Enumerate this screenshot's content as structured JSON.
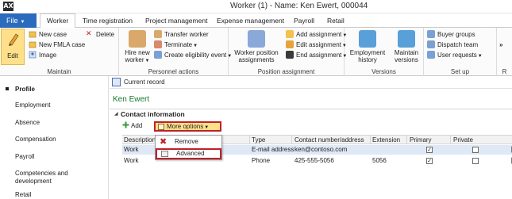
{
  "window": {
    "title": "Worker (1) - Name: Ken Ewert, 000044",
    "app_icon": "AX"
  },
  "ribbon_tabs": [
    {
      "label": "File"
    },
    {
      "label": "Worker"
    },
    {
      "label": "Time registration"
    },
    {
      "label": "Project management"
    },
    {
      "label": "Expense management"
    },
    {
      "label": "Payroll"
    },
    {
      "label": "Retail"
    }
  ],
  "ribbon": {
    "maintain": {
      "edit": "Edit",
      "new_case": "New case",
      "delete": "Delete",
      "new_fmla_case": "New FMLA case",
      "image": "Image",
      "label": "Maintain"
    },
    "personnel": {
      "hire_new": "Hire new",
      "worker": "worker",
      "transfer_worker": "Transfer worker",
      "terminate": "Terminate",
      "create_eligibility": "Create eligibility event",
      "label": "Personnel actions"
    },
    "position": {
      "worker_position": "Worker position",
      "assignments": "assignments",
      "add_assignment": "Add assignment",
      "edit_assignment": "Edit assignment",
      "end_assignment": "End assignment",
      "label": "Position assignment"
    },
    "versions": {
      "employment": "Employment",
      "history": "history",
      "maintain": "Maintain",
      "versions_btn": "versions",
      "label": "Versions"
    },
    "setup": {
      "buyer_groups": "Buyer groups",
      "dispatch_team": "Dispatch team",
      "user_requests": "User requests",
      "label": "Set up"
    },
    "overflow": {
      "label": "R"
    }
  },
  "nav": {
    "items": [
      {
        "label": "Profile"
      },
      {
        "label": "Employment"
      },
      {
        "label": "Absence"
      },
      {
        "label": "Compensation"
      },
      {
        "label": "Payroll"
      },
      {
        "label": "Competencies and"
      },
      {
        "label": "development"
      },
      {
        "label": "Retail"
      }
    ]
  },
  "content": {
    "current_record": "Current record",
    "worker_name": "Ken Ewert",
    "section_title": "Contact information",
    "add_label": "Add",
    "more_options": "More options",
    "columns": [
      "Description",
      "Type",
      "Contact number/address",
      "Extension",
      "Primary",
      "Private"
    ],
    "rows": [
      {
        "description": "Work",
        "type": "E-mail address",
        "contact": "ken@contoso.com",
        "extension": "",
        "primary": "✓",
        "private": ""
      },
      {
        "description": "Work",
        "type": "Phone",
        "contact": "425-555-5056",
        "extension": "5056",
        "primary": "✓",
        "private": ""
      }
    ]
  },
  "menu": {
    "remove": "Remove",
    "advanced": "Advanced"
  },
  "colors": {
    "file_tab": "#2a6bbd",
    "highlight": "#ffe08a",
    "annotation_red": "#c0202a",
    "worker_name_green": "#1a7a2a"
  }
}
